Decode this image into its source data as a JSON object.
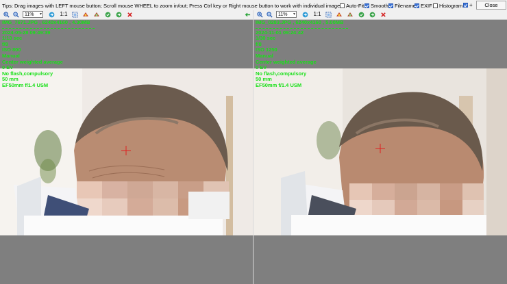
{
  "tips": "Tips: Drag images with LEFT mouse button; Scroll mouse WHEEL to zoom in/out; Press Ctrl key or Right mouse button to work with individual images.",
  "options": [
    {
      "label": "Auto-Fit",
      "checked": false
    },
    {
      "label": "Smooth",
      "checked": true
    },
    {
      "label": "Filename",
      "checked": true
    },
    {
      "label": "EXIF",
      "checked": true
    },
    {
      "label": "Histogram",
      "checked": false
    }
  ],
  "plus_label": "+",
  "close_label": "Close",
  "panes": [
    {
      "zoom": "11%",
      "one_to_one": "1:1",
      "exif": [
        "IMG_7671.JPG , 6240x4160 , 4.30MB",
        "2024-05-28 09:49:39",
        "1/13 sec",
        "f/8",
        "ISO 800",
        "Manual",
        "Center weighted average",
        "0 EV",
        "No flash,compulsory",
        "50 mm",
        "EF50mm f/1.4 USM"
      ]
    },
    {
      "zoom": "11%",
      "one_to_one": "1:1",
      "exif": [
        "IMG_0283.JPG , 6240x4160 , 5.00MB",
        "2024-11-01 09:24:42",
        "1/30 sec",
        "f/8",
        "ISO 1250",
        "Manual",
        "Center weighted average",
        "0 EV",
        "No flash,compulsory",
        "50 mm",
        "EF50mm f/1.4 USM"
      ]
    }
  ],
  "colors": {
    "exif_text": "#18e018",
    "crosshair": "#e02020",
    "background": "#7f7f7f"
  },
  "icons": [
    "zoom-in-icon",
    "zoom-out-icon",
    "fit-icon",
    "flip-icon",
    "rotate-icon",
    "save-icon",
    "arrow-left-icon",
    "arrow-right-icon",
    "delete-icon"
  ]
}
